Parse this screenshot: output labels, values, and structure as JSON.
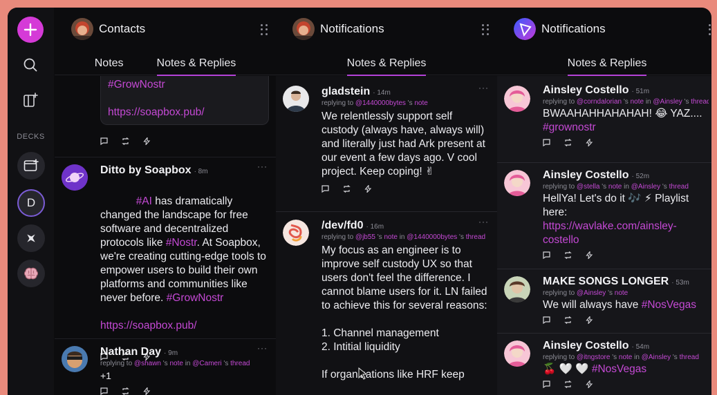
{
  "sidebar": {
    "decks_label": "DECKS",
    "deck_letter": "D"
  },
  "columns": [
    {
      "title": "Contacts",
      "tabs": [
        "Notes",
        "Notes & Replies"
      ],
      "posts": [
        {
          "card_lines": [
            "#GrowNostr",
            "",
            "https://soapbox.pub/"
          ]
        },
        {
          "name": "Ditto by Soapbox",
          "time": "8m",
          "more": "···",
          "text_parts": [
            {
              "h": "#AI"
            },
            {
              "t": " has dramatically changed the landscape for free software and decentralized protocols like "
            },
            {
              "h": "#Nostr"
            },
            {
              "t": ". At Soapbox, we're creating cutting-edge tools to empower users to build their own platforms and communities like never before. "
            },
            {
              "h": "#GrowNostr"
            },
            {
              "t": "\n\n"
            },
            {
              "h": "https://soapbox.pub/"
            }
          ]
        },
        {
          "name": "Nathan Day",
          "time": "9m",
          "more": "···",
          "reply": [
            {
              "t": "replying to "
            },
            {
              "m": "@shawn"
            },
            {
              "t": " 's "
            },
            {
              "m": "note"
            },
            {
              "t": " in "
            },
            {
              "m": "@Cameri"
            },
            {
              "t": " 's "
            },
            {
              "m": "thread"
            }
          ],
          "text_parts": [
            {
              "t": "+1"
            }
          ]
        }
      ]
    },
    {
      "title": "Notifications",
      "tabs": [
        "Notes & Replies"
      ],
      "posts": [
        {
          "name": "gladstein",
          "time": "14m",
          "more": "···",
          "reply": [
            {
              "t": "replying to "
            },
            {
              "m": "@1440000bytes"
            },
            {
              "t": " 's "
            },
            {
              "m": "note"
            }
          ],
          "text_parts": [
            {
              "t": "We relentlessly support self custody (always have, always will) and literally just had Ark present at our event a few days ago. V cool project. Keep coping! ✌"
            }
          ]
        },
        {
          "name": "/dev/fd0",
          "time": "16m",
          "more": "···",
          "reply": [
            {
              "t": "replying to "
            },
            {
              "m": "@jb55"
            },
            {
              "t": " 's "
            },
            {
              "m": "note"
            },
            {
              "t": " in "
            },
            {
              "m": "@1440000bytes"
            },
            {
              "t": " 's "
            },
            {
              "m": "thread"
            }
          ],
          "text_parts": [
            {
              "t": "My focus as an engineer is to improve self custody UX so that users don't feel the difference. I cannot blame users for it. LN failed to achieve this for several reasons:\n\n1. Channel management\n2. Intitial liquidity\n\nIf organizations like HRF keep"
            }
          ]
        }
      ]
    },
    {
      "title": "Notifications",
      "tabs": [
        "Notes & Replies"
      ],
      "posts": [
        {
          "name": "Ainsley Costello",
          "time": "51m",
          "reply": [
            {
              "t": "replying to "
            },
            {
              "m": "@corndalorian"
            },
            {
              "t": " 's "
            },
            {
              "m": "note"
            },
            {
              "t": " in "
            },
            {
              "m": "@Ainsley"
            },
            {
              "t": " 's "
            },
            {
              "m": "thread"
            }
          ],
          "text_parts": [
            {
              "t": "BWAAHAHHAHAHAH! 😂 YAZ...."
            },
            {
              "t": "\n"
            },
            {
              "h": "#grownostr"
            }
          ]
        },
        {
          "name": "Ainsley Costello",
          "time": "52m",
          "reply": [
            {
              "t": "replying to "
            },
            {
              "m": "@stella"
            },
            {
              "t": " 's "
            },
            {
              "m": "note"
            },
            {
              "t": " in "
            },
            {
              "m": "@Ainsley"
            },
            {
              "t": " 's "
            },
            {
              "m": "thread"
            }
          ],
          "text_parts": [
            {
              "t": "HellYa! Let's do it 🎶 ⚡ Playlist here:\n"
            },
            {
              "h": "https://wavlake.com/ainsley-costello"
            }
          ]
        },
        {
          "name": "MAKE SONGS LONGER",
          "time": "53m",
          "reply": [
            {
              "t": "replying to "
            },
            {
              "m": "@Ainsley"
            },
            {
              "t": " 's "
            },
            {
              "m": "note"
            }
          ],
          "text_parts": [
            {
              "t": "We will always have "
            },
            {
              "h": "#NosVegas"
            }
          ]
        },
        {
          "name": "Ainsley Costello",
          "time": "54m",
          "reply": [
            {
              "t": "replying to "
            },
            {
              "m": "@itngstore"
            },
            {
              "t": " 's "
            },
            {
              "m": "note"
            },
            {
              "t": " in "
            },
            {
              "m": "@Ainsley"
            },
            {
              "t": " 's "
            },
            {
              "m": "thread"
            }
          ],
          "text_parts": [
            {
              "t": "🍒 🤍 🤍 "
            },
            {
              "h": "#NosVegas"
            }
          ]
        }
      ]
    }
  ],
  "colors": {
    "accent": "#c449d4",
    "background": "#0c0c0e",
    "tab_underline": "#b542d8"
  }
}
